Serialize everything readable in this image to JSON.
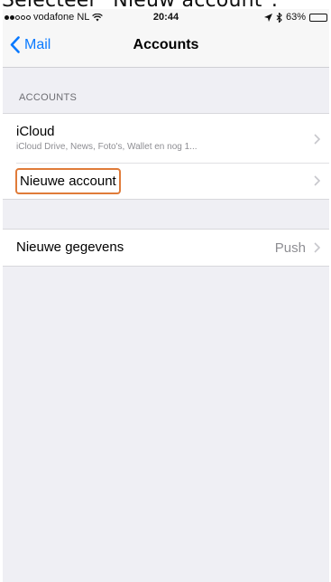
{
  "caption": "Selecteer \"Nieuw account\".",
  "status_bar": {
    "carrier": "vodafone NL",
    "signal_bars_filled": 2,
    "signal_bars_total": 5,
    "wifi_icon": "wifi-icon",
    "time": "20:44",
    "location_icon": "location-arrow-icon",
    "bluetooth_icon": "bluetooth-icon",
    "battery_percent": "63%",
    "battery_level": 0.63
  },
  "nav": {
    "back_label": "Mail",
    "title": "Accounts"
  },
  "accounts_section": {
    "header": "ACCOUNTS",
    "items": [
      {
        "title": "iCloud",
        "subtitle": "iCloud Drive, News, Foto's, Wallet en nog 1..."
      },
      {
        "title": "Nieuwe account",
        "highlighted": true
      }
    ]
  },
  "fetch_section": {
    "label": "Nieuwe gegevens",
    "value": "Push"
  },
  "colors": {
    "accent": "#0a7aff",
    "highlight": "#e07b39",
    "background": "#efeff4",
    "secondary_text": "#8e8e93"
  }
}
